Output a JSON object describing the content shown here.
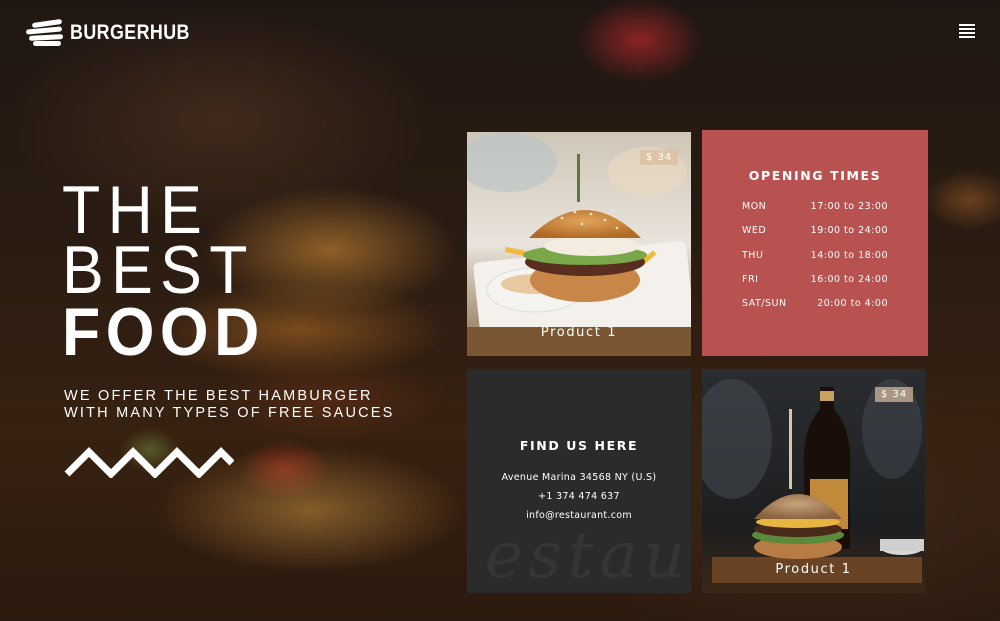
{
  "brand": {
    "name": "BURGERHUB"
  },
  "header": {
    "menu_icon": "hamburger-menu-icon"
  },
  "hero": {
    "line1": "THE",
    "line2": "BEST",
    "line3": "FOOD",
    "tagline_line1": "WE OFFER THE BEST HAMBURGER",
    "tagline_line2": "WITH MANY TYPES OF FREE SAUCES"
  },
  "products": [
    {
      "label": "Product 1",
      "price": "$ 34"
    },
    {
      "label": "Product 1",
      "price": "$ 34"
    }
  ],
  "opening_times": {
    "title": "OPENING TIMES",
    "rows": [
      {
        "day": "MON",
        "hours": "17:00 to 23:00"
      },
      {
        "day": "WED",
        "hours": "19:00 to 24:00"
      },
      {
        "day": "THU",
        "hours": "14:00 to 18:00"
      },
      {
        "day": "FRI",
        "hours": "16:00 to 24:00"
      },
      {
        "day": "SAT/SUN",
        "hours": "20:00 to 4:00"
      }
    ]
  },
  "find_us": {
    "title": "FIND US HERE",
    "address": "Avenue Marina 34568 NY (U.S)",
    "phone": "+1 374 474 637",
    "email": "info@restaurant.com"
  },
  "colors": {
    "hours_bg": "#b85250",
    "find_bg": "#2b2b2b",
    "text": "#ffffff"
  }
}
